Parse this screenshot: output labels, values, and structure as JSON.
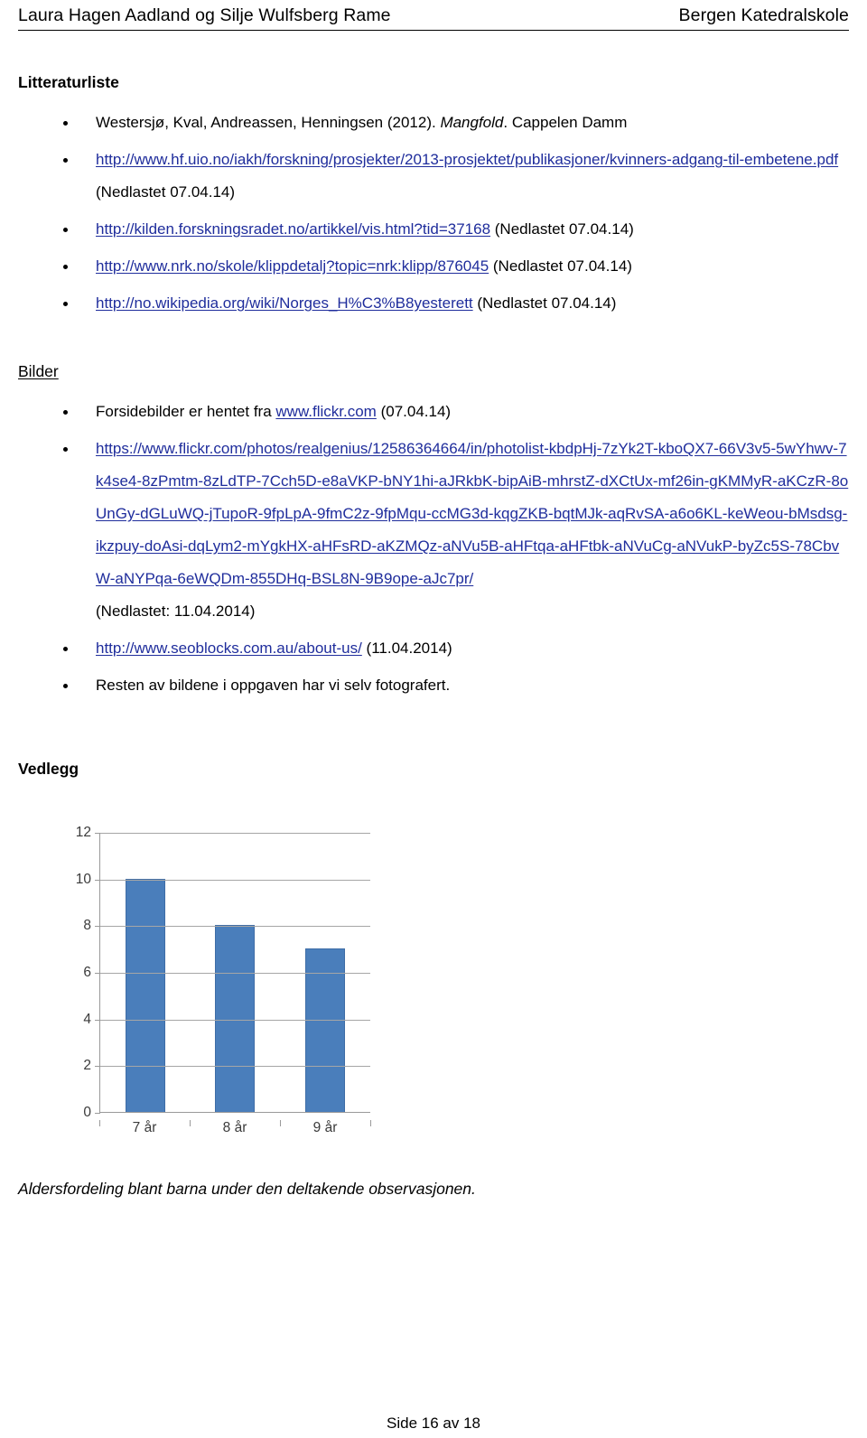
{
  "header": {
    "left": "Laura Hagen Aadland og Silje Wulfsberg Rame",
    "right": "Bergen Katedralskole"
  },
  "sections": {
    "litteraturliste_title": "Litteraturliste",
    "bilder_title": "Bilder",
    "vedlegg_title": "Vedlegg"
  },
  "litteraturliste": {
    "item1": {
      "pre": "Westersjø, Kval, Andreassen, Henningsen (2012). ",
      "italic": "Mangfold",
      "post": ". Cappelen Damm"
    },
    "item2": {
      "link": "http://www.hf.uio.no/iakh/forskning/prosjekter/2013-prosjektet/publikasjoner/kvinners-adgang-til-embetene.pdf",
      "note": " (Nedlastet 07.04.14)"
    },
    "item3": {
      "link": "http://kilden.forskningsradet.no/artikkel/vis.html?tid=37168",
      "note": " (Nedlastet 07.04.14)"
    },
    "item4": {
      "link": "http://www.nrk.no/skole/klippdetalj?topic=nrk:klipp/876045",
      "note": " (Nedlastet 07.04.14)"
    },
    "item5": {
      "link": "http://no.wikipedia.org/wiki/Norges_H%C3%B8yesterett",
      "note": " (Nedlastet 07.04.14)"
    }
  },
  "bilder": {
    "item1": {
      "pre": "Forsidebilder er hentet fra ",
      "link": "www.flickr.com",
      "note": " (07.04.14)"
    },
    "item2": {
      "link": "https://www.flickr.com/photos/realgenius/12586364664/in/photolist-kbdpHj-7zYk2T-kboQX7-66V3v5-5wYhwv-7k4se4-8zPmtm-8zLdTP-7Cch5D-e8aVKP-bNY1hi-aJRkbK-bipAiB-mhrstZ-dXCtUx-mf26in-gKMMyR-aKCzR-8oUnGy-dGLuWQ-jTupoR-9fpLpA-9fmC2z-9fpMqu-ccMG3d-kqgZKB-bqtMJk-aqRvSA-a6o6KL-keWeou-bMsdsg-ikzpuy-doAsi-dqLym2-mYgkHX-aHFsRD-aKZMQz-aNVu5B-aHFtqa-aHFtbk-aNVuCg-aNVukP-byZc5S-78CbvW-aNYPqa-6eWQDm-855DHq-BSL8N-9B9ope-aJc7pr/",
      "note": "(Nedlastet: 11.04.2014)"
    },
    "item3": {
      "link": "http://www.seoblocks.com.au/about-us/",
      "note": " (11.04.2014)"
    },
    "item4": {
      "text": "Resten av bildene i oppgaven har vi selv fotografert."
    }
  },
  "chart_data": {
    "type": "bar",
    "title": "",
    "xlabel": "",
    "ylabel": "",
    "categories": [
      "7 år",
      "8 år",
      "9 år"
    ],
    "values": [
      10,
      8,
      7
    ],
    "ylim": [
      0,
      12
    ],
    "yticks": [
      "0",
      "2",
      "4",
      "6",
      "8",
      "10",
      "12"
    ],
    "grid": true,
    "legend": "none",
    "series_color": "#4a7ebb"
  },
  "caption": "Aldersfordeling blant barna under den deltakende observasjonen.",
  "footer": "Side 16 av 18"
}
